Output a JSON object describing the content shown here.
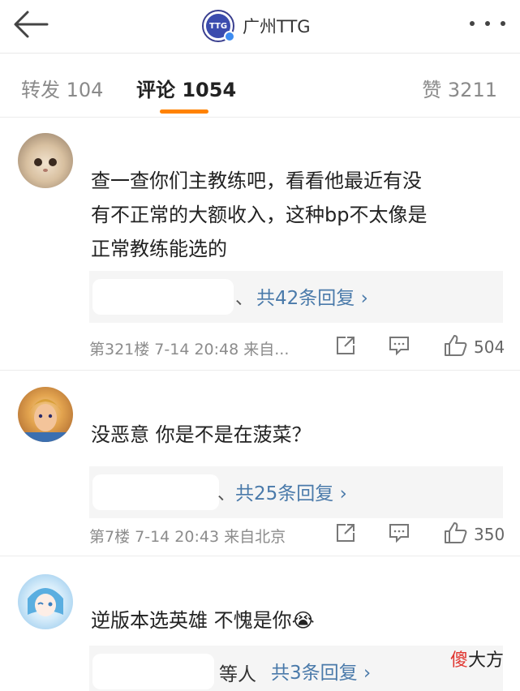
{
  "header": {
    "title": "广州TTG",
    "logo_text": "TTG"
  },
  "tabs": {
    "repost": "转发 104",
    "comments": "评论 1054",
    "likes": "赞 3211"
  },
  "comments": [
    {
      "text_lines": [
        "查一查你们主教练吧，看看他最近有没",
        "有不正常的大额收入，这种bp不太像是",
        "正常教练能选的"
      ],
      "reply_sep": "、",
      "reply_count": "共42条回复 ›",
      "floor_info": "第321楼  7-14 20:48  来自...",
      "likes": "504"
    },
    {
      "text_lines": [
        "没恶意 你是不是在菠菜？"
      ],
      "reply_sep": "、",
      "reply_count": "共25条回复 ›",
      "floor_info": "第7楼  7-14 20:43  来自北京",
      "likes": "350"
    },
    {
      "text_lines": [
        "逆版本选英雄 不愧是你😭"
      ],
      "reply_sep": "等人",
      "reply_count": "共3条回复 ›"
    }
  ],
  "watermark": {
    "red": "傻",
    "black": "大方"
  },
  "colors": {
    "accent": "#ff8200",
    "link": "#4a7aaa",
    "verified": "#3d8cf0"
  }
}
